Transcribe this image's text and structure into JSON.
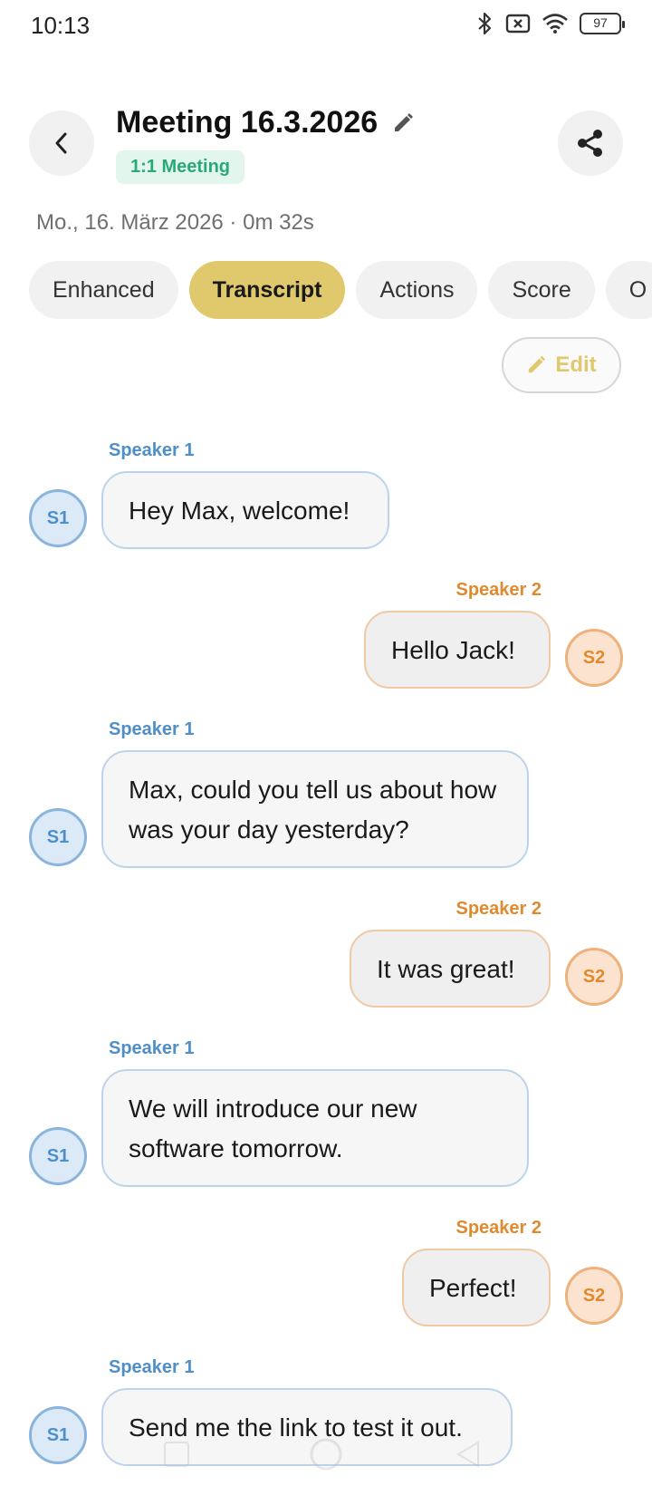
{
  "status_bar": {
    "time": "10:13",
    "battery": "97"
  },
  "header": {
    "title": "Meeting 16.3.2026",
    "meeting_type": "1:1 Meeting",
    "date_line": "Mo., 16. März 2026  · 0m 32s"
  },
  "tabs": [
    {
      "label": "Enhanced",
      "active": false
    },
    {
      "label": "Transcript",
      "active": true
    },
    {
      "label": "Actions",
      "active": false
    },
    {
      "label": "Score",
      "active": false
    },
    {
      "label": "O",
      "active": false
    }
  ],
  "edit_label": "Edit",
  "messages": [
    {
      "speaker": "Speaker 1",
      "avatar": "S1",
      "text": "Hey Max, welcome!"
    },
    {
      "speaker": "Speaker 2",
      "avatar": "S2",
      "text": "Hello Jack!"
    },
    {
      "speaker": "Speaker 1",
      "avatar": "S1",
      "text": "Max, could you tell us about how was your day yesterday?"
    },
    {
      "speaker": "Speaker 2",
      "avatar": "S2",
      "text": "It was great!"
    },
    {
      "speaker": "Speaker 1",
      "avatar": "S1",
      "text": "We will introduce our new software tomorrow."
    },
    {
      "speaker": "Speaker 2",
      "avatar": "S2",
      "text": "Perfect!"
    },
    {
      "speaker": "Speaker 1",
      "avatar": "S1",
      "text": "Send me the link to test it out."
    }
  ],
  "colors": {
    "accent": "#e0c86d",
    "speaker1": "#4f8fc9",
    "speaker2": "#e08a2e",
    "pill_text": "#2aa876"
  }
}
